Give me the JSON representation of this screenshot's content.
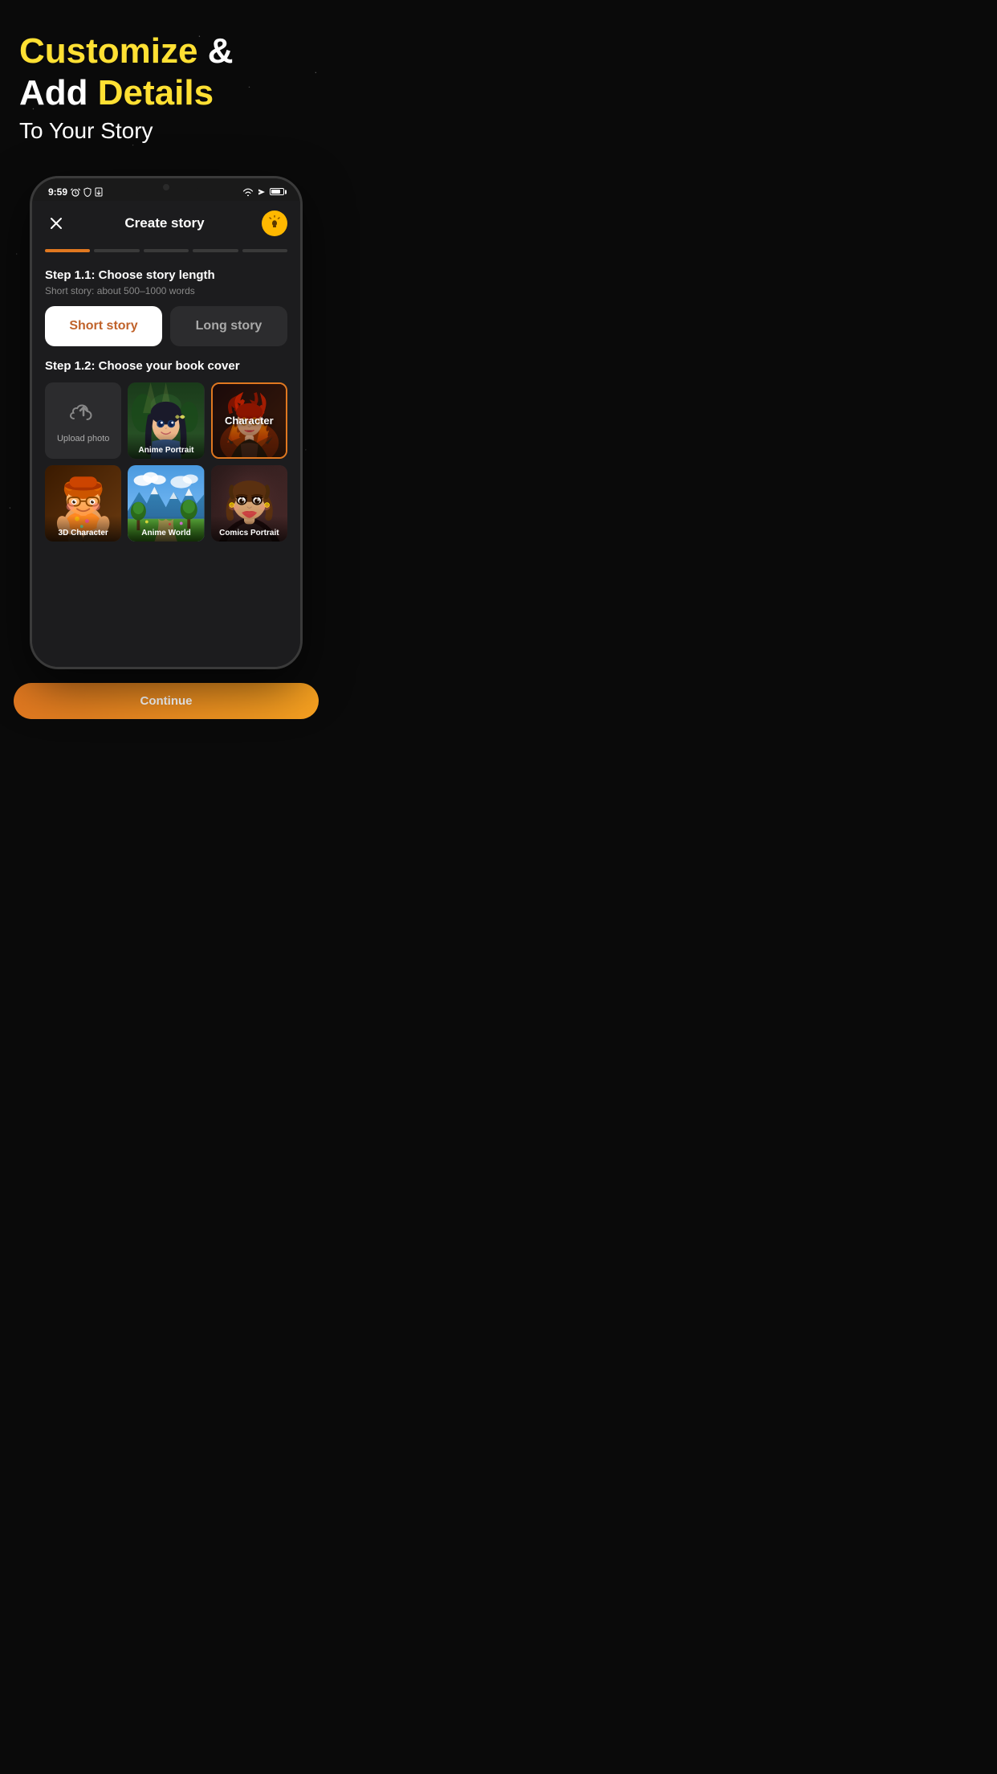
{
  "background": "#0a0a0a",
  "header": {
    "line1_yellow": "Customize",
    "line1_amp": " &",
    "line2_white": "Add ",
    "line2_yellow": "Details",
    "subtitle": "To Your Story"
  },
  "phone": {
    "status_time": "9:59",
    "nav_title": "Create story",
    "close_label": "×",
    "hint_label": "?",
    "progress_segments": 5,
    "progress_active": 1,
    "step1_title": "Step 1.1: Choose story length",
    "step1_subtitle": "Short story: about 500–1000 words",
    "story_short_label": "Short story",
    "story_long_label": "Long story",
    "step2_title": "Step 1.2: Choose your book cover",
    "cards": [
      {
        "id": "upload",
        "label": "Upload photo",
        "type": "upload"
      },
      {
        "id": "anime-portrait",
        "label": "Anime Portrait",
        "type": "art",
        "art": "anime_portrait"
      },
      {
        "id": "character",
        "label": "Character",
        "type": "art",
        "art": "character",
        "selected": true
      },
      {
        "id": "3d-character",
        "label": "3D Character",
        "type": "art",
        "art": "3d_character"
      },
      {
        "id": "anime-world",
        "label": "Anime World",
        "type": "art",
        "art": "anime_world"
      },
      {
        "id": "comics-portrait",
        "label": "Comics Portrait",
        "type": "art",
        "art": "comics_portrait"
      }
    ]
  }
}
